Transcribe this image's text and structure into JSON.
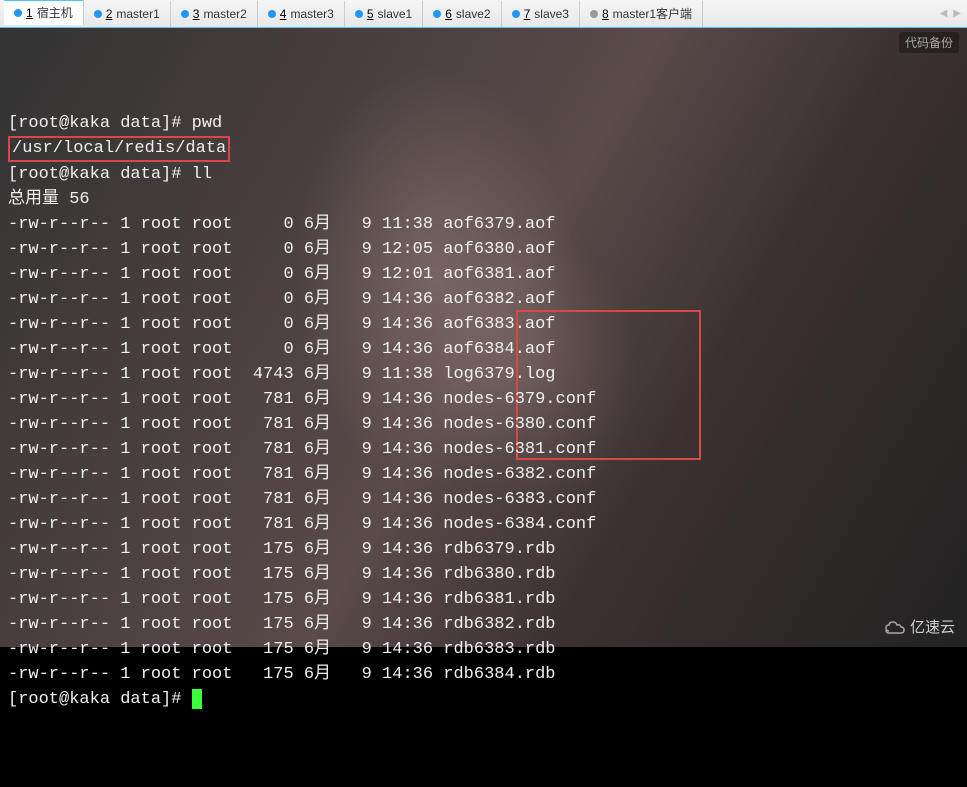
{
  "tabs": [
    {
      "num": "1",
      "label": "宿主机",
      "active": true,
      "dot": "blue"
    },
    {
      "num": "2",
      "label": "master1",
      "dot": "blue"
    },
    {
      "num": "3",
      "label": "master2",
      "dot": "blue"
    },
    {
      "num": "4",
      "label": "master3",
      "dot": "blue"
    },
    {
      "num": "5",
      "label": "slave1",
      "dot": "blue"
    },
    {
      "num": "6",
      "label": "slave2",
      "dot": "blue"
    },
    {
      "num": "7",
      "label": "slave3",
      "dot": "blue"
    },
    {
      "num": "8",
      "label": "master1客户端",
      "dot": "gray"
    }
  ],
  "nav": {
    "left": "◀",
    "right": "▶"
  },
  "badge_tr": "代码备份",
  "logo_br": "亿速云",
  "prompt": "[root@kaka data]# ",
  "cmd_pwd": "pwd",
  "path": "/usr/local/redis/data",
  "cmd_ll": "ll",
  "total_label": "总用量 56",
  "rows": [
    {
      "perm": "-rw-r--r-- 1 root root     0 6月   9 11:38 ",
      "name": "aof6379.aof"
    },
    {
      "perm": "-rw-r--r-- 1 root root     0 6月   9 12:05 ",
      "name": "aof6380.aof"
    },
    {
      "perm": "-rw-r--r-- 1 root root     0 6月   9 12:01 ",
      "name": "aof6381.aof"
    },
    {
      "perm": "-rw-r--r-- 1 root root     0 6月   9 14:36 ",
      "name": "aof6382.aof"
    },
    {
      "perm": "-rw-r--r-- 1 root root     0 6月   9 14:36 ",
      "name": "aof6383.aof"
    },
    {
      "perm": "-rw-r--r-- 1 root root     0 6月   9 14:36 ",
      "name": "aof6384.aof"
    },
    {
      "perm": "-rw-r--r-- 1 root root  4743 6月   9 11:38 ",
      "name": "log6379.log"
    },
    {
      "perm": "-rw-r--r-- 1 root root   781 6月   9 14:36 ",
      "name": "nodes-6379.conf"
    },
    {
      "perm": "-rw-r--r-- 1 root root   781 6月   9 14:36 ",
      "name": "nodes-6380.conf"
    },
    {
      "perm": "-rw-r--r-- 1 root root   781 6月   9 14:36 ",
      "name": "nodes-6381.conf"
    },
    {
      "perm": "-rw-r--r-- 1 root root   781 6月   9 14:36 ",
      "name": "nodes-6382.conf"
    },
    {
      "perm": "-rw-r--r-- 1 root root   781 6月   9 14:36 ",
      "name": "nodes-6383.conf"
    },
    {
      "perm": "-rw-r--r-- 1 root root   781 6月   9 14:36 ",
      "name": "nodes-6384.conf"
    },
    {
      "perm": "-rw-r--r-- 1 root root   175 6月   9 14:36 ",
      "name": "rdb6379.rdb"
    },
    {
      "perm": "-rw-r--r-- 1 root root   175 6月   9 14:36 ",
      "name": "rdb6380.rdb"
    },
    {
      "perm": "-rw-r--r-- 1 root root   175 6月   9 14:36 ",
      "name": "rdb6381.rdb"
    },
    {
      "perm": "-rw-r--r-- 1 root root   175 6月   9 14:36 ",
      "name": "rdb6382.rdb"
    },
    {
      "perm": "-rw-r--r-- 1 root root   175 6月   9 14:36 ",
      "name": "rdb6383.rdb"
    },
    {
      "perm": "-rw-r--r-- 1 root root   175 6月   9 14:36 ",
      "name": "rdb6384.rdb"
    }
  ]
}
